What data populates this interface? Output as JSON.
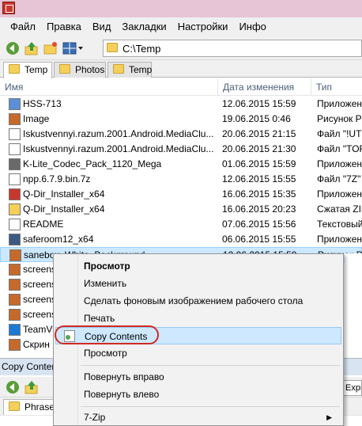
{
  "menubar": {
    "items": [
      "Файл",
      "Правка",
      "Вид",
      "Закладки",
      "Настройки",
      "Инфо"
    ]
  },
  "toolbar": {
    "address": "C:\\Temp"
  },
  "tabs": [
    {
      "label": "Temp"
    },
    {
      "label": "Photos"
    },
    {
      "label": "Temp"
    }
  ],
  "columns": {
    "name": "Имя",
    "date": "Дата изменения",
    "type": "Тип"
  },
  "files": [
    {
      "name": "HSS-713",
      "date": "12.06.2015 15:59",
      "type": "Приложен",
      "icon": "globe-app-icon"
    },
    {
      "name": "Image",
      "date": "19.06.2015 0:46",
      "type": "Рисунок P",
      "icon": "image-icon"
    },
    {
      "name": "Iskustvennyi.razum.2001.Android.MediaClu...",
      "date": "20.06.2015 21:15",
      "type": "Файл \"!UT",
      "icon": "file-icon"
    },
    {
      "name": "Iskustvennyi.razum.2001.Android.MediaClu...",
      "date": "20.06.2015 21:30",
      "type": "Файл \"TOF",
      "icon": "file-icon"
    },
    {
      "name": "K-Lite_Codec_Pack_1120_Mega",
      "date": "01.06.2015 15:59",
      "type": "Приложен",
      "icon": "codec-icon"
    },
    {
      "name": "npp.6.7.9.bin.7z",
      "date": "12.06.2015 15:55",
      "type": "Файл \"7Z\"",
      "icon": "file-icon"
    },
    {
      "name": "Q-Dir_Installer_x64",
      "date": "16.06.2015 15:35",
      "type": "Приложен",
      "icon": "qdir-icon"
    },
    {
      "name": "Q-Dir_Installer_x64",
      "date": "16.06.2015 20:23",
      "type": "Сжатая ZIP",
      "icon": "zip-folder-icon"
    },
    {
      "name": "README",
      "date": "07.06.2015 15:56",
      "type": "Текстовый",
      "icon": "text-file-icon"
    },
    {
      "name": "saferoom12_x64",
      "date": "06.06.2015 15:55",
      "type": "Приложен",
      "icon": "app-icon"
    },
    {
      "name": "sanebox_White_Background",
      "date": "12.06.2015 15:59",
      "type": "Рисунок P",
      "icon": "image-icon"
    },
    {
      "name": "screensh",
      "date": "",
      "type": "",
      "icon": "image-icon"
    },
    {
      "name": "screensh",
      "date": "",
      "type": "",
      "icon": "image-icon"
    },
    {
      "name": "screensh",
      "date": "",
      "type": "",
      "icon": "image-icon"
    },
    {
      "name": "screensh",
      "date": "",
      "type": "",
      "icon": "image-icon"
    },
    {
      "name": "TeamVie",
      "date": "",
      "type": "",
      "icon": "teamviewer-icon"
    },
    {
      "name": "Скрин",
      "date": "",
      "type": "",
      "icon": "image-icon"
    }
  ],
  "status": {
    "text": "Copy Conten"
  },
  "lower_pane": {
    "tab": "PhraseE",
    "address_fragment": "Expre"
  },
  "context_menu": {
    "items": [
      {
        "label": "Просмотр",
        "bold": true
      },
      {
        "label": "Изменить"
      },
      {
        "label": "Сделать фоновым изображением рабочего стола"
      },
      {
        "label": "Печать"
      },
      {
        "label": "Copy Contents",
        "highlighted": true
      },
      {
        "label": "Просмотр"
      },
      {
        "label": "Повернуть вправо"
      },
      {
        "label": "Повернуть влево"
      },
      {
        "label": "7-Zip",
        "submenu": true
      }
    ]
  },
  "colors": {
    "titlebar": "#e8c5d6",
    "selection": "#cce8ff",
    "highlight_ring": "#d22a22",
    "status_bar": "#d9e4f2"
  }
}
